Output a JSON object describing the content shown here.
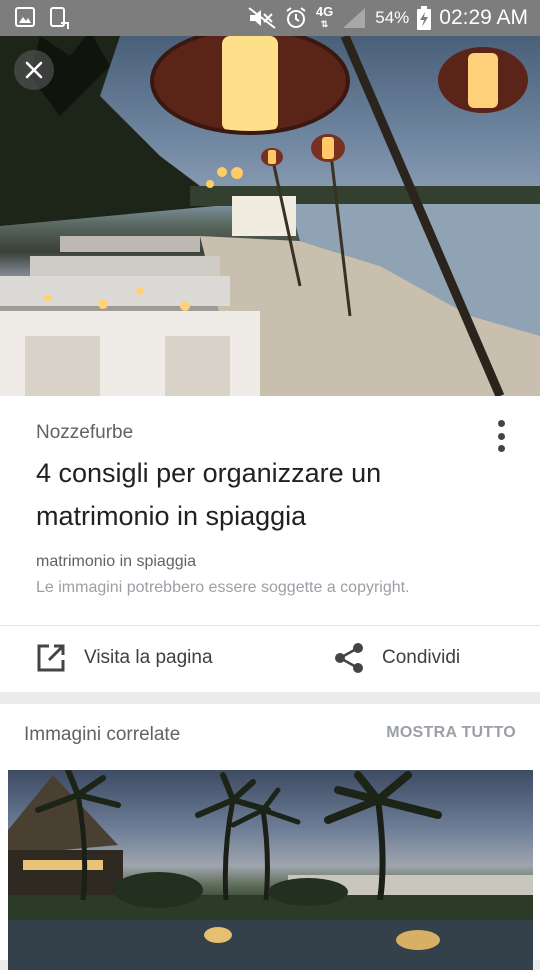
{
  "status_bar": {
    "network": "4G",
    "battery_percent": "54%",
    "time": "02:29 AM"
  },
  "detail": {
    "source": "Nozzefurbe",
    "title": "4 consigli per organizzare un matrimonio in spiaggia",
    "subtitle": "matrimonio in spiaggia",
    "copyright": "Le immagini potrebbero essere soggette a copyright.",
    "visit_label": "Visita la pagina",
    "share_label": "Condividi"
  },
  "related": {
    "title": "Immagini correlate",
    "show_all": "MOSTRA TUTTO"
  },
  "icons": {
    "close": "close-icon",
    "more": "more-vert-icon",
    "visit": "open-in-new-icon",
    "share": "share-icon"
  }
}
